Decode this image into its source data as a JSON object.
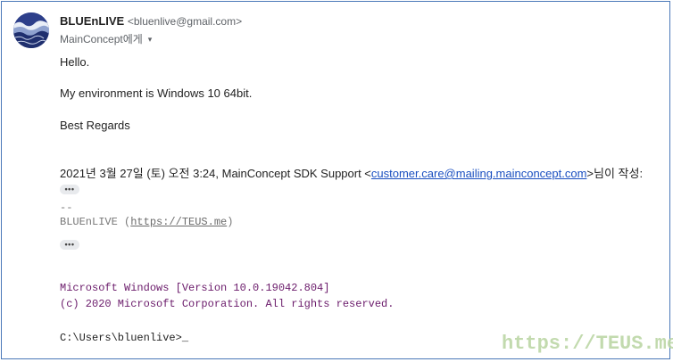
{
  "sender": {
    "name": "BLUEnLIVE",
    "email": "<bluenlive@gmail.com>"
  },
  "recipient": {
    "label": "MainConcept에게",
    "caret": "▾"
  },
  "body": {
    "greeting": "Hello.",
    "line1": "My environment is Windows 10 64bit.",
    "closing": "Best Regards"
  },
  "quote": {
    "prefix": "2021년 3월 27일 (토) 오전 3:24, MainConcept SDK Support <",
    "email": "customer.care@mailing.mainconcept.com",
    "suffix": ">님이 작성:",
    "ellipsis": "•••"
  },
  "signature": {
    "separator": "--",
    "name": "BLUEnLIVE (",
    "link": "https://TEUS.me",
    "close": ")",
    "ellipsis": "•••"
  },
  "console": {
    "line1": "Microsoft Windows [Version 10.0.19042.804]",
    "line2": "(c) 2020 Microsoft Corporation. All rights reserved.",
    "prompt": "C:\\Users\\bluenlive>",
    "cursor": "_"
  },
  "watermark": "https://TEUS.me",
  "colors": {
    "link": "#1a4fc0",
    "console_text": "#6a1a6a",
    "frame_border": "#4a78b8",
    "watermark": "#bcd7a6"
  }
}
